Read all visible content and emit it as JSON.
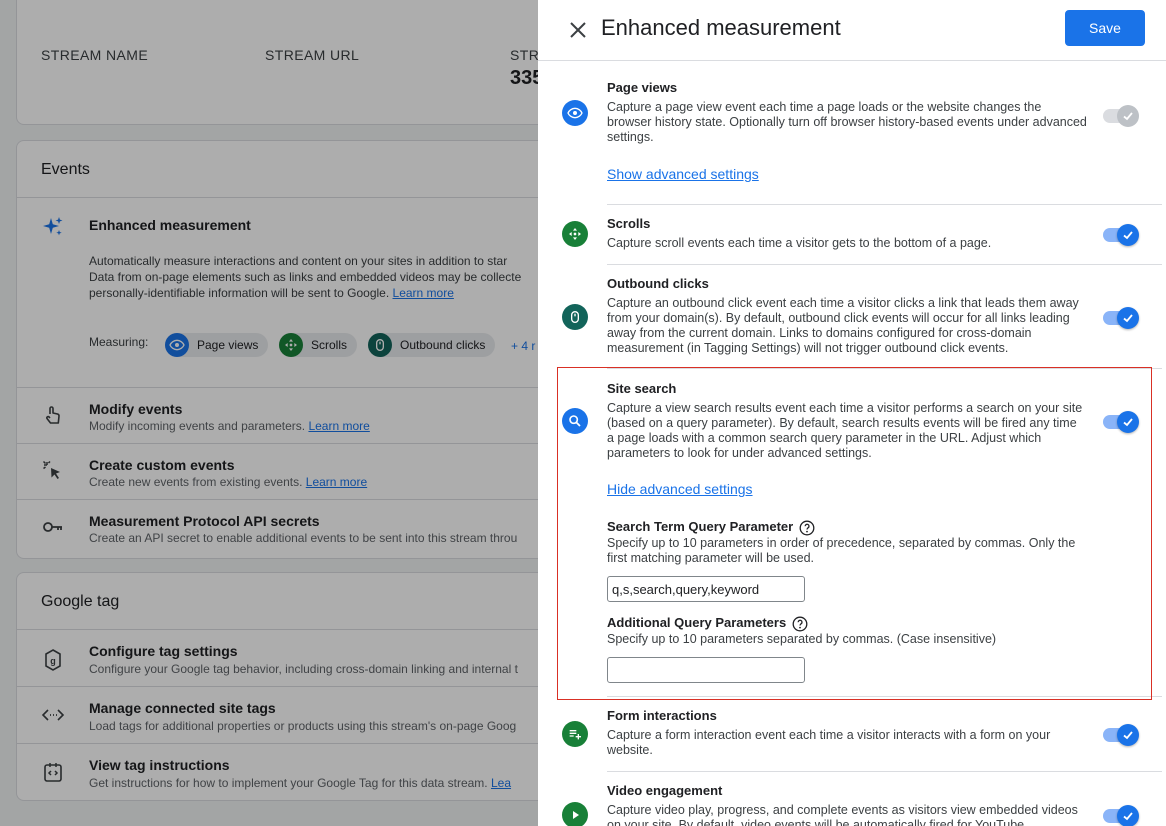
{
  "background": {
    "stream": {
      "col_name": "STREAM NAME",
      "col_url": "STREAM URL",
      "col_id": "STR",
      "id_value": "335"
    },
    "events": {
      "title": "Events",
      "enhanced": {
        "title": "Enhanced measurement",
        "desc_line1": "Automatically measure interactions and content on your sites in addition to star",
        "desc_line2": "Data from on-page elements such as links and embedded videos may be collecte",
        "desc_line3": "personally-identifiable information will be sent to Google.",
        "learn_more": "Learn more",
        "measuring_label": "Measuring:",
        "chips": [
          "Page views",
          "Scrolls",
          "Outbound clicks"
        ],
        "more": "+ 4 r"
      },
      "rows": [
        {
          "title": "Modify events",
          "desc": "Modify incoming events and parameters.",
          "link": "Learn more"
        },
        {
          "title": "Create custom events",
          "desc": "Create new events from existing events.",
          "link": "Learn more"
        },
        {
          "title": "Measurement Protocol API secrets",
          "desc": "Create an API secret to enable additional events to be sent into this stream throu",
          "link": ""
        }
      ]
    },
    "gtag": {
      "title": "Google tag",
      "rows": [
        {
          "title": "Configure tag settings",
          "desc": "Configure your Google tag behavior, including cross-domain linking and internal t",
          "link": ""
        },
        {
          "title": "Manage connected site tags",
          "desc": "Load tags for additional properties or products using this stream's on-page Goog",
          "link": ""
        },
        {
          "title": "View tag instructions",
          "desc": "Get instructions for how to implement your Google Tag for this data stream.",
          "link": "Lea"
        }
      ]
    }
  },
  "panel": {
    "title": "Enhanced measurement",
    "save_label": "Save",
    "sections": [
      {
        "title": "Page views",
        "desc": "Capture a page view event each time a page loads or the website changes the browser history state. Optionally turn off browser history-based events under advanced settings.",
        "link": "Show advanced settings",
        "enabled": true,
        "disabled": true
      },
      {
        "title": "Scrolls",
        "desc": "Capture scroll events each time a visitor gets to the bottom of a page.",
        "enabled": true
      },
      {
        "title": "Outbound clicks",
        "desc": "Capture an outbound click event each time a visitor clicks a link that leads them away from your domain(s). By default, outbound click events will occur for all links leading away from the current domain. Links to domains configured for cross-domain measurement (in Tagging Settings) will not trigger outbound click events.",
        "enabled": true
      },
      {
        "title": "Site search",
        "desc": "Capture a view search results event each time a visitor performs a search on your site (based on a query parameter). By default, search results events will be fired any time a page loads with a common search query parameter in the URL. Adjust which parameters to look for under advanced settings.",
        "link": "Hide advanced settings",
        "enabled": true
      },
      {
        "title": "Form interactions",
        "desc": "Capture a form interaction event each time a visitor interacts with a form on your website.",
        "enabled": true
      },
      {
        "title": "Video engagement",
        "desc": "Capture video play, progress, and complete events as visitors view embedded videos on your site. By default, video events will be automatically fired for YouTube",
        "enabled": true
      }
    ],
    "site_search_fields": {
      "search_term_label": "Search Term Query Parameter",
      "search_term_desc": "Specify up to 10 parameters in order of precedence, separated by commas. Only the first matching parameter will be used.",
      "search_term_value": "q,s,search,query,keyword",
      "additional_label": "Additional Query Parameters",
      "additional_desc": "Specify up to 10 parameters separated by commas. (Case insensitive)",
      "additional_value": ""
    }
  },
  "colors": {
    "accent": "#1a73e8",
    "icon_blue": "#1a73e8",
    "icon_green": "#188038",
    "icon_teal": "#12645a",
    "highlight": "#d93025"
  }
}
